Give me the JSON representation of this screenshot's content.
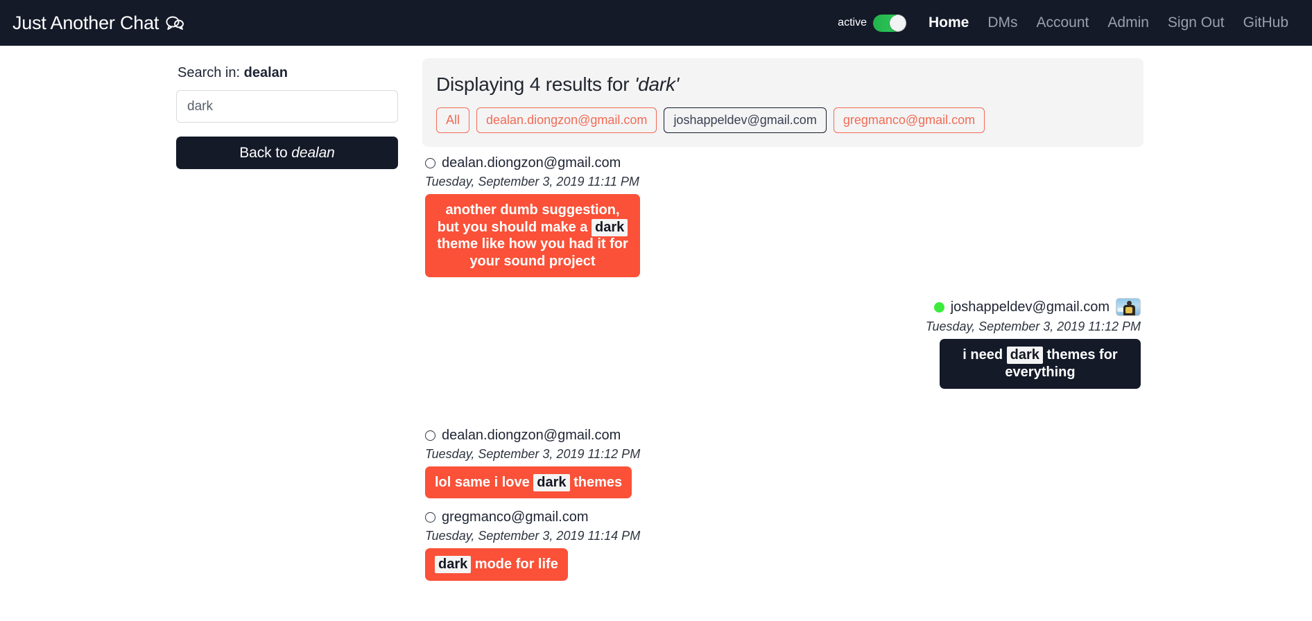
{
  "navbar": {
    "brand": "Just Another Chat",
    "brand_icon": "chat-bubbles-icon",
    "status_label": "active",
    "status_toggle_on": true,
    "links": [
      {
        "label": "Home",
        "active": true
      },
      {
        "label": "DMs",
        "active": false
      },
      {
        "label": "Account",
        "active": false
      },
      {
        "label": "Admin",
        "active": false
      },
      {
        "label": "Sign Out",
        "active": false
      },
      {
        "label": "GitHub",
        "active": false
      }
    ]
  },
  "sidebar": {
    "search_in_prefix": "Search in: ",
    "search_in_room": "dealan",
    "search_value": "dark",
    "search_placeholder": "dark",
    "back_prefix": "Back to ",
    "back_room": "dealan"
  },
  "results": {
    "heading_prefix": "Displaying 4 results for ",
    "heading_query": "'dark'",
    "result_count": 4,
    "query": "dark",
    "filters": [
      {
        "label": "All",
        "selected": false
      },
      {
        "label": "dealan.diongzon@gmail.com",
        "selected": false
      },
      {
        "label": "joshappeldev@gmail.com",
        "selected": true
      },
      {
        "label": "gregmanco@gmail.com",
        "selected": false
      }
    ]
  },
  "messages": [
    {
      "side": "left",
      "author": "dealan.diongzon@gmail.com",
      "status_icon": "circle-outline-icon",
      "online": false,
      "has_avatar": false,
      "timestamp": "Tuesday, September 3, 2019 11:11 PM",
      "bubble_theme": "orange",
      "width_class": "w-310",
      "parts": [
        {
          "text": "another dumb suggestion, but you should make a ",
          "highlight": false
        },
        {
          "text": "dark",
          "highlight": true
        },
        {
          "text": " theme like how you had it for your sound project",
          "highlight": false
        }
      ]
    },
    {
      "side": "right",
      "author": "joshappeldev@gmail.com",
      "status_icon": "circle-filled-icon",
      "online": true,
      "has_avatar": true,
      "avatar_icon": "user-photo-avatar",
      "timestamp": "Tuesday, September 3, 2019 11:12 PM",
      "bubble_theme": "dark",
      "width_class": "w-290",
      "parts": [
        {
          "text": "i need ",
          "highlight": false
        },
        {
          "text": "dark",
          "highlight": true
        },
        {
          "text": " themes for everything",
          "highlight": false
        }
      ]
    },
    {
      "side": "left",
      "author": "dealan.diongzon@gmail.com",
      "status_icon": "circle-outline-icon",
      "online": false,
      "has_avatar": false,
      "timestamp": "Tuesday, September 3, 2019 11:12 PM",
      "bubble_theme": "orange",
      "width_class": "",
      "parts": [
        {
          "text": "lol same i love ",
          "highlight": false
        },
        {
          "text": "dark",
          "highlight": true
        },
        {
          "text": " themes",
          "highlight": false
        }
      ]
    },
    {
      "side": "left",
      "author": "gregmanco@gmail.com",
      "status_icon": "circle-outline-icon",
      "online": false,
      "has_avatar": false,
      "timestamp": "Tuesday, September 3, 2019 11:14 PM",
      "bubble_theme": "orange",
      "width_class": "",
      "parts": [
        {
          "text": "dark",
          "highlight": true
        },
        {
          "text": " mode for life",
          "highlight": false
        }
      ]
    }
  ],
  "colors": {
    "navbar_bg": "#141a28",
    "accent_orange": "#fa5138",
    "bubble_dark": "#141a28",
    "panel_bg": "#f4f4f5",
    "filter_border": "#f26b55",
    "online_green": "#3bec3b",
    "toggle_green": "#2fc75a"
  }
}
